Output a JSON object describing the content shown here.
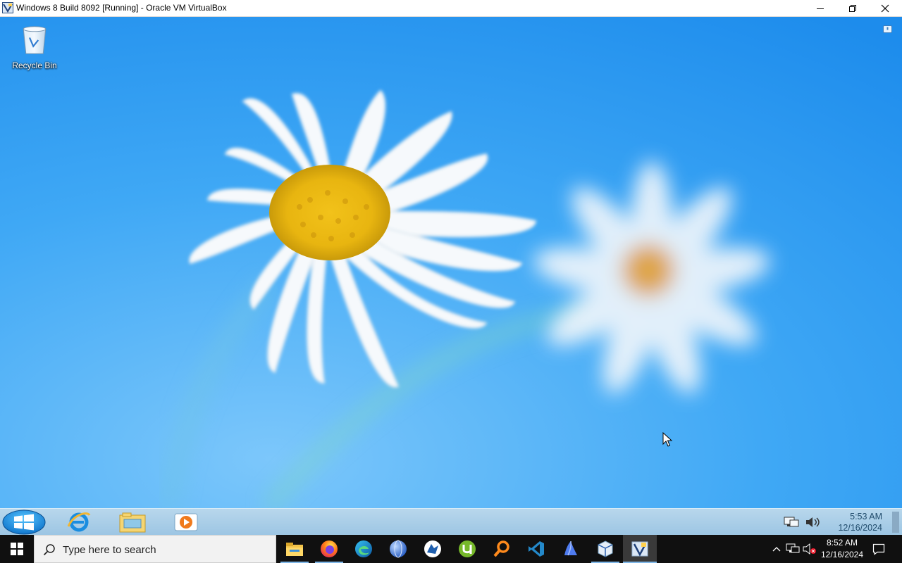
{
  "host_window": {
    "title": "Windows 8 Build 8092 [Running] - Oracle VM VirtualBox",
    "controls": [
      "minimize",
      "restore",
      "close"
    ]
  },
  "desktop": {
    "icons": [
      {
        "label": "Recycle Bin",
        "icon": "recycle-bin-icon"
      }
    ],
    "wallpaper": "daisies-on-blue"
  },
  "guest_taskbar": {
    "pinned": [
      {
        "name": "internet-explorer",
        "icon": "ie-icon"
      },
      {
        "name": "file-explorer",
        "icon": "folder-icon"
      },
      {
        "name": "media-player",
        "icon": "media-player-icon"
      }
    ],
    "tray_icons": [
      "network-icon",
      "volume-icon"
    ],
    "clock": {
      "time": "5:53 AM",
      "date": "12/16/2024"
    }
  },
  "host_taskbar": {
    "search_placeholder": "Type here to search",
    "apps": [
      {
        "name": "file-explorer",
        "icon": "folder-icon"
      },
      {
        "name": "firefox",
        "icon": "firefox-icon"
      },
      {
        "name": "edge",
        "icon": "edge-icon"
      },
      {
        "name": "globe-app",
        "icon": "globe-icon"
      },
      {
        "name": "virtualbox-manager",
        "icon": "vbox-manager-icon"
      },
      {
        "name": "utorrent",
        "icon": "utorrent-icon"
      },
      {
        "name": "search-tool",
        "icon": "magnifier-icon"
      },
      {
        "name": "visual-studio-code",
        "icon": "vscode-icon"
      },
      {
        "name": "app-blue",
        "icon": "blue-app-icon"
      },
      {
        "name": "virtualbox",
        "icon": "virtualbox-icon"
      },
      {
        "name": "virtualbox-vm",
        "icon": "vm-window-icon",
        "active": true
      }
    ],
    "tray_icons": [
      "chevron-up-icon",
      "network-icon",
      "volume-muted-icon"
    ],
    "clock": {
      "time": "8:52 AM",
      "date": "12/16/2024"
    }
  },
  "colors": {
    "sky": "#2f9ff2",
    "host_taskbar": "#101010",
    "guest_taskbar": "#a8cfe8"
  }
}
